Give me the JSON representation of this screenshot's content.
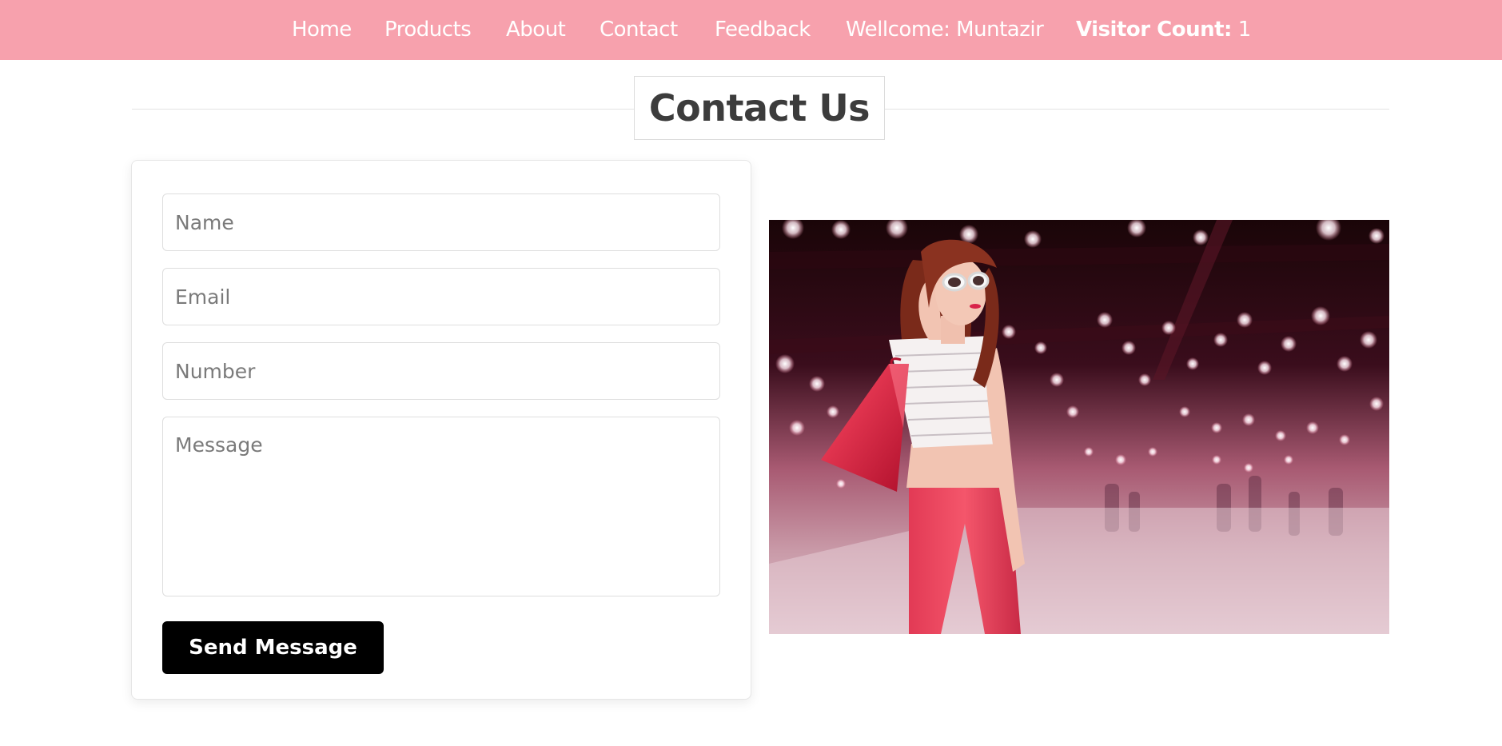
{
  "nav": {
    "items": [
      {
        "label": "Home"
      },
      {
        "label": "Products"
      },
      {
        "label": "About"
      },
      {
        "label": "Contact"
      },
      {
        "label": "Feedback"
      },
      {
        "label": "Wellcome: Muntazir"
      }
    ],
    "visitor_label": "Visitor Count:",
    "visitor_value": "1"
  },
  "page": {
    "title": "Contact Us"
  },
  "form": {
    "name_placeholder": "Name",
    "email_placeholder": "Email",
    "number_placeholder": "Number",
    "message_placeholder": "Message",
    "submit_label": "Send Message"
  },
  "colors": {
    "navbar": "#f7a1ad",
    "button": "#000000",
    "heading": "#3c3c3c"
  }
}
